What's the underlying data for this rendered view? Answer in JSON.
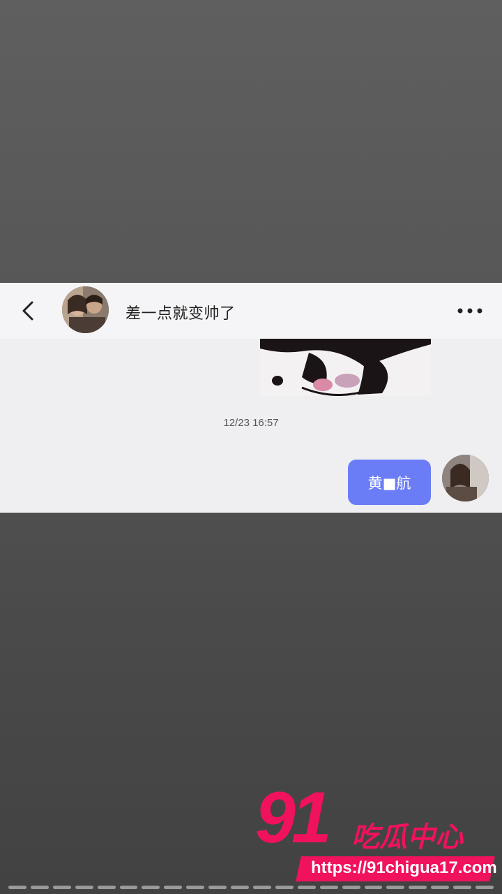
{
  "header": {
    "title": "差一点就变帅了",
    "back_icon": "chevron-left-icon",
    "more_icon": "more-horizontal-icon"
  },
  "messages": {
    "timestamp": "12/23 16:57",
    "outgoing_text": "黄■航"
  },
  "watermark": {
    "number": "91",
    "title": "吃瓜中心",
    "url": "https://91chigua17.com",
    "color": "#f0125c"
  },
  "colors": {
    "bubble": "#6b7cf7",
    "panel": "#efeff1"
  },
  "progress_segments": 22
}
